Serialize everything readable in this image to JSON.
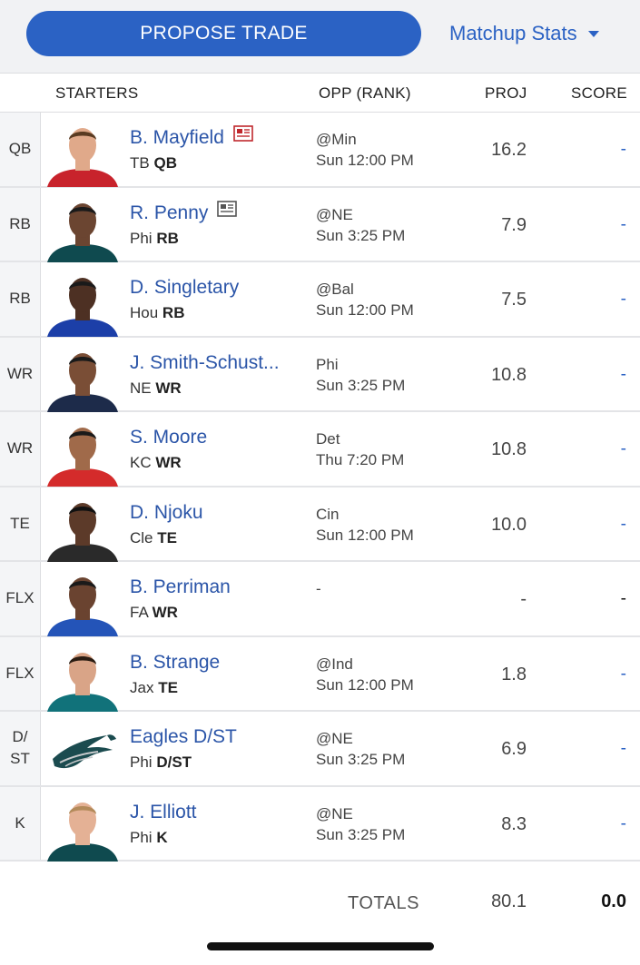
{
  "toolbar": {
    "propose_label": "PROPOSE TRADE",
    "matchup_label": "Matchup Stats"
  },
  "header": {
    "starters": "STARTERS",
    "opp": "OPP (RANK)",
    "proj": "PROJ",
    "score": "SCORE"
  },
  "rows": [
    {
      "slot": "QB",
      "name": "B. Mayfield",
      "team": "TB",
      "pos": "QB",
      "opp": "@Min",
      "time": "Sun 12:00 PM",
      "proj": "16.2",
      "score": "-",
      "news": true,
      "news_color": "#c0282d",
      "jersey": "#c8232c",
      "skin": "#e0a98a",
      "hair": "#5a3b22"
    },
    {
      "slot": "RB",
      "name": "R. Penny",
      "team": "Phi",
      "pos": "RB",
      "opp": "@NE",
      "time": "Sun 3:25 PM",
      "proj": "7.9",
      "score": "-",
      "news": true,
      "news_color": "#555555",
      "jersey": "#0f4a4f",
      "skin": "#6b4531",
      "hair": "#1a1a1a"
    },
    {
      "slot": "RB",
      "name": "D. Singletary",
      "team": "Hou",
      "pos": "RB",
      "opp": "@Bal",
      "time": "Sun 12:00 PM",
      "proj": "7.5",
      "score": "-",
      "news": false,
      "jersey": "#1c3fa8",
      "skin": "#4d3023",
      "hair": "#1a1a1a"
    },
    {
      "slot": "WR",
      "name": "J. Smith-Schust...",
      "team": "NE",
      "pos": "WR",
      "opp": "Phi",
      "time": "Sun 3:25 PM",
      "proj": "10.8",
      "score": "-",
      "news": false,
      "jersey": "#1d2b4a",
      "skin": "#7a4e36",
      "hair": "#1a1a1a"
    },
    {
      "slot": "WR",
      "name": "S. Moore",
      "team": "KC",
      "pos": "WR",
      "opp": "Det",
      "time": "Thu 7:20 PM",
      "proj": "10.8",
      "score": "-",
      "news": false,
      "jersey": "#d42b2b",
      "skin": "#a06a4a",
      "hair": "#1a1a1a"
    },
    {
      "slot": "TE",
      "name": "D. Njoku",
      "team": "Cle",
      "pos": "TE",
      "opp": "Cin",
      "time": "Sun 12:00 PM",
      "proj": "10.0",
      "score": "-",
      "news": false,
      "jersey": "#2a2a2a",
      "skin": "#5c3a29",
      "hair": "#111111"
    },
    {
      "slot": "FLX",
      "name": "B. Perriman",
      "team": "FA",
      "pos": "WR",
      "opp": "-",
      "time": "",
      "proj": "-",
      "score": "-",
      "news": false,
      "dark_score": true,
      "jersey": "#2454b8",
      "skin": "#6a4330",
      "hair": "#1a1a1a"
    },
    {
      "slot": "FLX",
      "name": "B. Strange",
      "team": "Jax",
      "pos": "TE",
      "opp": "@Ind",
      "time": "Sun 12:00 PM",
      "proj": "1.8",
      "score": "-",
      "news": false,
      "jersey": "#11727a",
      "skin": "#d9a487",
      "hair": "#2a1c12"
    },
    {
      "slot": "D/ ST",
      "name": "Eagles D/ST",
      "team": "Phi",
      "pos": "D/ST",
      "opp": "@NE",
      "time": "Sun 3:25 PM",
      "proj": "6.9",
      "score": "-",
      "news": false,
      "logo": true
    },
    {
      "slot": "K",
      "name": "J. Elliott",
      "team": "Phi",
      "pos": "K",
      "opp": "@NE",
      "time": "Sun 3:25 PM",
      "proj": "8.3",
      "score": "-",
      "news": false,
      "jersey": "#0f4a4f",
      "skin": "#e4b195",
      "hair": "#b38a5a"
    }
  ],
  "totals": {
    "label": "TOTALS",
    "proj": "80.1",
    "score": "0.0"
  },
  "colors": {
    "accent": "#2b62c4",
    "link": "#2b55a8"
  }
}
